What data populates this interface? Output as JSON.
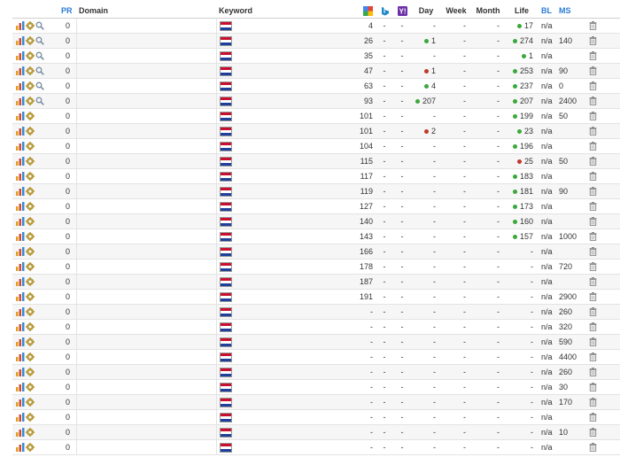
{
  "colors": {
    "accent": "#2a7bd4",
    "up": "#3aa83a",
    "down": "#c0392b"
  },
  "headers": {
    "pr": "PR",
    "domain": "Domain",
    "keyword": "Keyword",
    "google": "google-icon",
    "bing": "bing-icon",
    "yahoo": "yahoo-icon",
    "day": "Day",
    "week": "Week",
    "month": "Month",
    "life": "Life",
    "bl": "BL",
    "ms": "MS"
  },
  "rows": [
    {
      "tools": 3,
      "pr": "0",
      "rank": "4",
      "b": "-",
      "y": "-",
      "day": "-",
      "dayDir": "",
      "week": "-",
      "month": "-",
      "life": "17",
      "lifeDir": "up",
      "bl": "n/a",
      "ms": ""
    },
    {
      "tools": 3,
      "pr": "0",
      "rank": "26",
      "b": "-",
      "y": "-",
      "day": "1",
      "dayDir": "up",
      "week": "-",
      "month": "-",
      "life": "274",
      "lifeDir": "up",
      "bl": "n/a",
      "ms": "140"
    },
    {
      "tools": 3,
      "pr": "0",
      "rank": "35",
      "b": "-",
      "y": "-",
      "day": "-",
      "dayDir": "",
      "week": "-",
      "month": "-",
      "life": "1",
      "lifeDir": "up",
      "bl": "n/a",
      "ms": ""
    },
    {
      "tools": 3,
      "pr": "0",
      "rank": "47",
      "b": "-",
      "y": "-",
      "day": "1",
      "dayDir": "down",
      "week": "-",
      "month": "-",
      "life": "253",
      "lifeDir": "up",
      "bl": "n/a",
      "ms": "90"
    },
    {
      "tools": 3,
      "pr": "0",
      "rank": "63",
      "b": "-",
      "y": "-",
      "day": "4",
      "dayDir": "up",
      "week": "-",
      "month": "-",
      "life": "237",
      "lifeDir": "up",
      "bl": "n/a",
      "ms": "0"
    },
    {
      "tools": 3,
      "pr": "0",
      "rank": "93",
      "b": "-",
      "y": "-",
      "day": "207",
      "dayDir": "up",
      "week": "-",
      "month": "-",
      "life": "207",
      "lifeDir": "up",
      "bl": "n/a",
      "ms": "2400"
    },
    {
      "tools": 2,
      "pr": "0",
      "rank": "101",
      "b": "-",
      "y": "-",
      "day": "-",
      "dayDir": "",
      "week": "-",
      "month": "-",
      "life": "199",
      "lifeDir": "up",
      "bl": "n/a",
      "ms": "50"
    },
    {
      "tools": 2,
      "pr": "0",
      "rank": "101",
      "b": "-",
      "y": "-",
      "day": "2",
      "dayDir": "down",
      "week": "-",
      "month": "-",
      "life": "23",
      "lifeDir": "up",
      "bl": "n/a",
      "ms": ""
    },
    {
      "tools": 2,
      "pr": "0",
      "rank": "104",
      "b": "-",
      "y": "-",
      "day": "-",
      "dayDir": "",
      "week": "-",
      "month": "-",
      "life": "196",
      "lifeDir": "up",
      "bl": "n/a",
      "ms": ""
    },
    {
      "tools": 2,
      "pr": "0",
      "rank": "115",
      "b": "-",
      "y": "-",
      "day": "-",
      "dayDir": "",
      "week": "-",
      "month": "-",
      "life": "25",
      "lifeDir": "down",
      "bl": "n/a",
      "ms": "50"
    },
    {
      "tools": 2,
      "pr": "0",
      "rank": "117",
      "b": "-",
      "y": "-",
      "day": "-",
      "dayDir": "",
      "week": "-",
      "month": "-",
      "life": "183",
      "lifeDir": "up",
      "bl": "n/a",
      "ms": ""
    },
    {
      "tools": 2,
      "pr": "0",
      "rank": "119",
      "b": "-",
      "y": "-",
      "day": "-",
      "dayDir": "",
      "week": "-",
      "month": "-",
      "life": "181",
      "lifeDir": "up",
      "bl": "n/a",
      "ms": "90"
    },
    {
      "tools": 2,
      "pr": "0",
      "rank": "127",
      "b": "-",
      "y": "-",
      "day": "-",
      "dayDir": "",
      "week": "-",
      "month": "-",
      "life": "173",
      "lifeDir": "up",
      "bl": "n/a",
      "ms": ""
    },
    {
      "tools": 2,
      "pr": "0",
      "rank": "140",
      "b": "-",
      "y": "-",
      "day": "-",
      "dayDir": "",
      "week": "-",
      "month": "-",
      "life": "160",
      "lifeDir": "up",
      "bl": "n/a",
      "ms": ""
    },
    {
      "tools": 2,
      "pr": "0",
      "rank": "143",
      "b": "-",
      "y": "-",
      "day": "-",
      "dayDir": "",
      "week": "-",
      "month": "-",
      "life": "157",
      "lifeDir": "up",
      "bl": "n/a",
      "ms": "1000"
    },
    {
      "tools": 2,
      "pr": "0",
      "rank": "166",
      "b": "-",
      "y": "-",
      "day": "-",
      "dayDir": "",
      "week": "-",
      "month": "-",
      "life": "-",
      "lifeDir": "",
      "bl": "n/a",
      "ms": ""
    },
    {
      "tools": 2,
      "pr": "0",
      "rank": "178",
      "b": "-",
      "y": "-",
      "day": "-",
      "dayDir": "",
      "week": "-",
      "month": "-",
      "life": "-",
      "lifeDir": "",
      "bl": "n/a",
      "ms": "720"
    },
    {
      "tools": 2,
      "pr": "0",
      "rank": "187",
      "b": "-",
      "y": "-",
      "day": "-",
      "dayDir": "",
      "week": "-",
      "month": "-",
      "life": "-",
      "lifeDir": "",
      "bl": "n/a",
      "ms": ""
    },
    {
      "tools": 2,
      "pr": "0",
      "rank": "191",
      "b": "-",
      "y": "-",
      "day": "-",
      "dayDir": "",
      "week": "-",
      "month": "-",
      "life": "-",
      "lifeDir": "",
      "bl": "n/a",
      "ms": "2900"
    },
    {
      "tools": 2,
      "pr": "0",
      "rank": "-",
      "b": "-",
      "y": "-",
      "day": "-",
      "dayDir": "",
      "week": "-",
      "month": "-",
      "life": "-",
      "lifeDir": "",
      "bl": "n/a",
      "ms": "260"
    },
    {
      "tools": 2,
      "pr": "0",
      "rank": "-",
      "b": "-",
      "y": "-",
      "day": "-",
      "dayDir": "",
      "week": "-",
      "month": "-",
      "life": "-",
      "lifeDir": "",
      "bl": "n/a",
      "ms": "320"
    },
    {
      "tools": 2,
      "pr": "0",
      "rank": "-",
      "b": "-",
      "y": "-",
      "day": "-",
      "dayDir": "",
      "week": "-",
      "month": "-",
      "life": "-",
      "lifeDir": "",
      "bl": "n/a",
      "ms": "590"
    },
    {
      "tools": 2,
      "pr": "0",
      "rank": "-",
      "b": "-",
      "y": "-",
      "day": "-",
      "dayDir": "",
      "week": "-",
      "month": "-",
      "life": "-",
      "lifeDir": "",
      "bl": "n/a",
      "ms": "4400"
    },
    {
      "tools": 2,
      "pr": "0",
      "rank": "-",
      "b": "-",
      "y": "-",
      "day": "-",
      "dayDir": "",
      "week": "-",
      "month": "-",
      "life": "-",
      "lifeDir": "",
      "bl": "n/a",
      "ms": "260"
    },
    {
      "tools": 2,
      "pr": "0",
      "rank": "-",
      "b": "-",
      "y": "-",
      "day": "-",
      "dayDir": "",
      "week": "-",
      "month": "-",
      "life": "-",
      "lifeDir": "",
      "bl": "n/a",
      "ms": "30"
    },
    {
      "tools": 2,
      "pr": "0",
      "rank": "-",
      "b": "-",
      "y": "-",
      "day": "-",
      "dayDir": "",
      "week": "-",
      "month": "-",
      "life": "-",
      "lifeDir": "",
      "bl": "n/a",
      "ms": "170"
    },
    {
      "tools": 2,
      "pr": "0",
      "rank": "-",
      "b": "-",
      "y": "-",
      "day": "-",
      "dayDir": "",
      "week": "-",
      "month": "-",
      "life": "-",
      "lifeDir": "",
      "bl": "n/a",
      "ms": ""
    },
    {
      "tools": 2,
      "pr": "0",
      "rank": "-",
      "b": "-",
      "y": "-",
      "day": "-",
      "dayDir": "",
      "week": "-",
      "month": "-",
      "life": "-",
      "lifeDir": "",
      "bl": "n/a",
      "ms": "10"
    },
    {
      "tools": 2,
      "pr": "0",
      "rank": "-",
      "b": "-",
      "y": "-",
      "day": "-",
      "dayDir": "",
      "week": "-",
      "month": "-",
      "life": "-",
      "lifeDir": "",
      "bl": "n/a",
      "ms": ""
    }
  ]
}
